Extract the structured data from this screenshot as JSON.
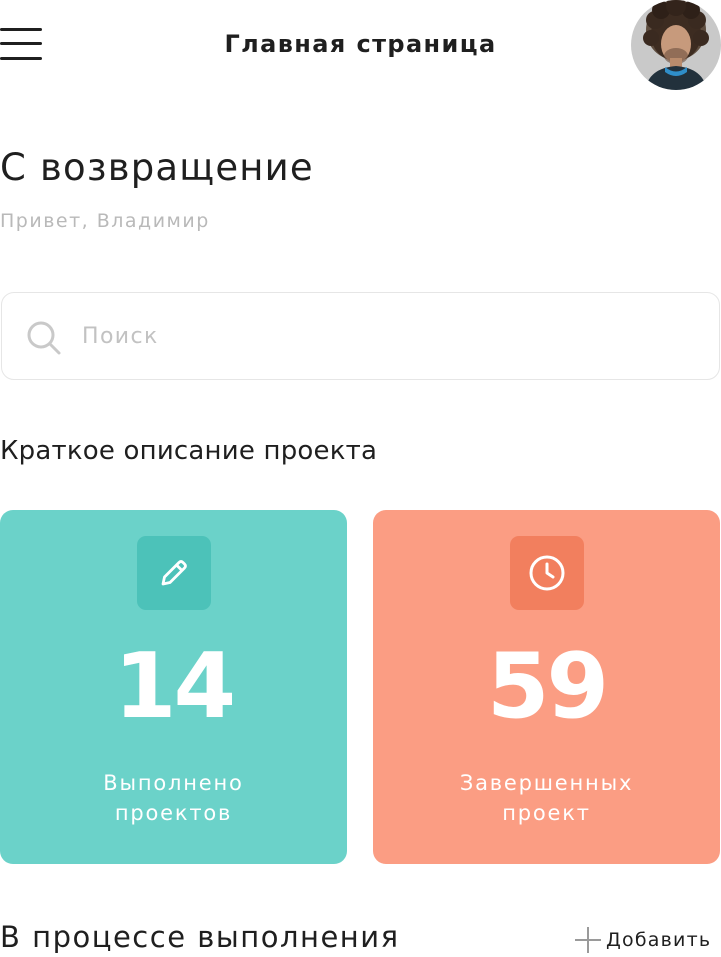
{
  "header": {
    "title": "Главная страница",
    "menu_icon": "hamburger-icon"
  },
  "welcome": {
    "heading": "С возвращение",
    "greeting": "Привет, Владимир"
  },
  "search": {
    "placeholder": "Поиск",
    "value": "",
    "icon": "search-icon"
  },
  "overview": {
    "title": "Краткое описание проекта",
    "cards": [
      {
        "icon": "pencil-icon",
        "number": "14",
        "label_line1": "Выполнено",
        "label_line2": "проектов",
        "color": "#6bd2c9"
      },
      {
        "icon": "clock-icon",
        "number": "59",
        "label_line1": "Завершенных",
        "label_line2": "проект",
        "color": "#fb9d83"
      }
    ]
  },
  "in_progress": {
    "title": "В процессе выполнения",
    "add_label": "Добавить",
    "add_icon": "plus-icon"
  }
}
